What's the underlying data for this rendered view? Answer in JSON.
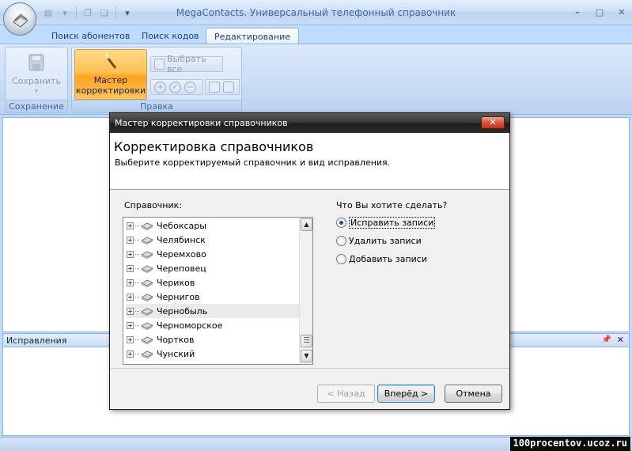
{
  "app": {
    "title": "MegaContacts. Универсальный телефонный справочник"
  },
  "tabs": [
    {
      "label": "Поиск абонентов"
    },
    {
      "label": "Поиск кодов"
    },
    {
      "label": "Редактирование"
    }
  ],
  "ribbon": {
    "save_group": {
      "button": "Сохранить",
      "label": "Сохранение"
    },
    "edit_group": {
      "wizard_line1": "Мастер",
      "wizard_line2": "корректировки",
      "select_all": "Выбрать все",
      "label": "Правка"
    }
  },
  "panel": {
    "title": "Исправления"
  },
  "dialog": {
    "title": "Мастер корректировки справочников",
    "heading": "Корректировка справочников",
    "subtitle": "Выберите корректируемый справочник  и вид исправления.",
    "list_label": "Справочник:",
    "items": [
      "Чебоксары",
      "Челябинск",
      "Черемхово",
      "Череповец",
      "Чериков",
      "Чернигов",
      "Чернобыль",
      "Черноморское",
      "Чортков",
      "Чунский"
    ],
    "selected_item": "Чернобыль",
    "question": "Что Вы хотите сделать?",
    "options": [
      "Исправить записи",
      "Удалить записи",
      "Добавить записи"
    ],
    "selected_option": "Исправить записи",
    "buttons": {
      "back": "< Назад",
      "next": "Вперёд >",
      "cancel": "Отмена"
    }
  },
  "watermark": "100procentov.ucoz.ru",
  "colors": {
    "ribbon_bg": "#bfdbff",
    "highlight": "#ffc154",
    "dialog_title": "#2e2e2e",
    "close_btn": "#d5553a"
  }
}
